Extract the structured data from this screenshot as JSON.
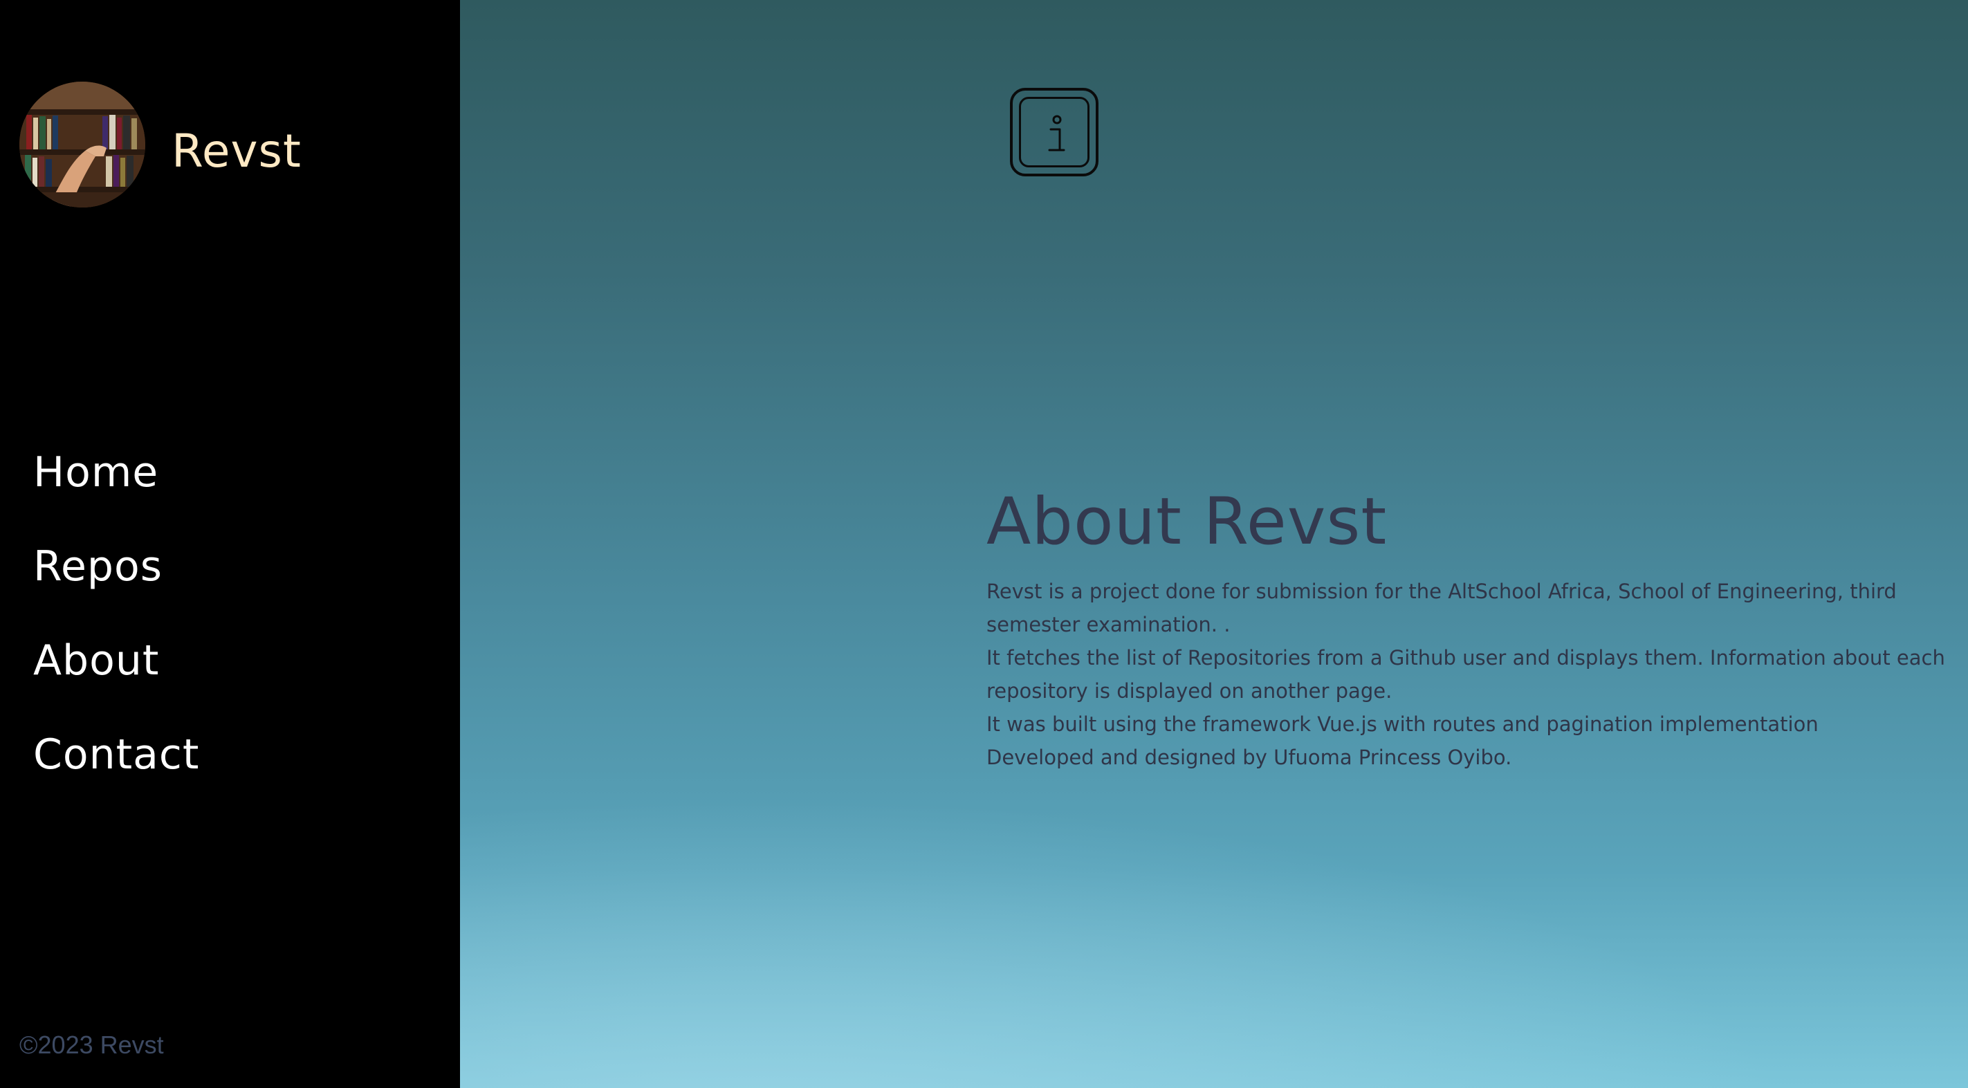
{
  "brand": {
    "name": "Revst",
    "avatar_icon": "bookshelf-photo-avatar"
  },
  "nav": {
    "items": [
      {
        "label": "Home"
      },
      {
        "label": "Repos"
      },
      {
        "label": "About"
      },
      {
        "label": "Contact"
      }
    ]
  },
  "footer": {
    "text": "©2023 Revst"
  },
  "main": {
    "info_icon": "info-icon",
    "title": "About Revst",
    "paragraphs": [
      "Revst is a project done for submission for the AltSchool Africa, School of Engineering, third semester examination. .",
      "It fetches the list of Repositories from a Github user and displays them. Information about each repository is displayed on another page.",
      "It was built using the framework Vue.js with routes and pagination implementation",
      "Developed and designed by Ufuoma Princess Oyibo."
    ]
  },
  "colors": {
    "sidebar_bg": "#000000",
    "brand_text": "#ffe9c4",
    "nav_text": "#ffffff",
    "footer_text": "#3d4a63",
    "heading_text": "#33394f",
    "body_text": "#2f3548",
    "main_bg_top": "#2f5a5f",
    "main_bg_bottom": "#7cc6da"
  }
}
